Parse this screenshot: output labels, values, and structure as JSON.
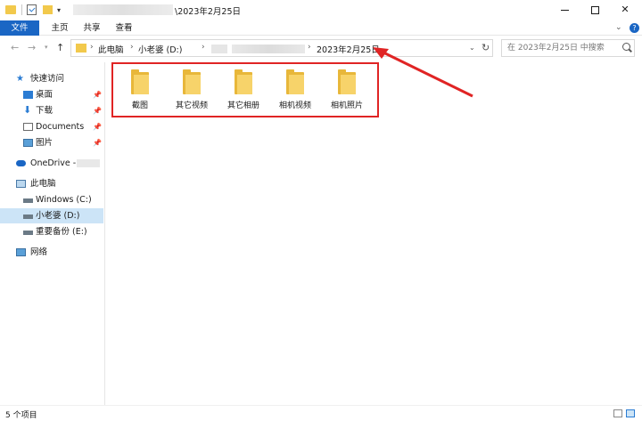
{
  "window": {
    "title": "\\2023年2月25日"
  },
  "ribbon": {
    "tabs": [
      {
        "label": "文件"
      },
      {
        "label": "主页"
      },
      {
        "label": "共享"
      },
      {
        "label": "查看"
      }
    ]
  },
  "address": {
    "crumbs": [
      "此电脑",
      "小老婆 (D:)",
      "2023年2月25日"
    ],
    "search_placeholder": "在 2023年2月25日 中搜索"
  },
  "sidebar": {
    "items": [
      {
        "label": "快速访问",
        "icon": "star-icon"
      },
      {
        "label": "桌面",
        "icon": "desktop-icon",
        "pinned": true
      },
      {
        "label": "下载",
        "icon": "download-icon",
        "pinned": true
      },
      {
        "label": "Documents",
        "icon": "document-icon",
        "pinned": true
      },
      {
        "label": "图片",
        "icon": "pictures-icon",
        "pinned": true
      },
      {
        "label": "OneDrive -",
        "icon": "onedrive-icon"
      },
      {
        "label": "此电脑",
        "icon": "computer-icon"
      },
      {
        "label": "Windows (C:)",
        "icon": "drive-icon"
      },
      {
        "label": "小老婆 (D:)",
        "icon": "drive-icon",
        "selected": true
      },
      {
        "label": "重要备份 (E:)",
        "icon": "drive-icon"
      },
      {
        "label": "网络",
        "icon": "network-icon"
      }
    ]
  },
  "content": {
    "folders": [
      {
        "name": "截图"
      },
      {
        "name": "其它视频"
      },
      {
        "name": "其它相册"
      },
      {
        "name": "相机视频"
      },
      {
        "name": "相机照片"
      }
    ]
  },
  "status": {
    "item_count": "5 个项目"
  },
  "colors": {
    "accent": "#1a66c4",
    "annotation": "#e02424",
    "folder": "#f7d36a",
    "selected": "#cce4f7"
  }
}
